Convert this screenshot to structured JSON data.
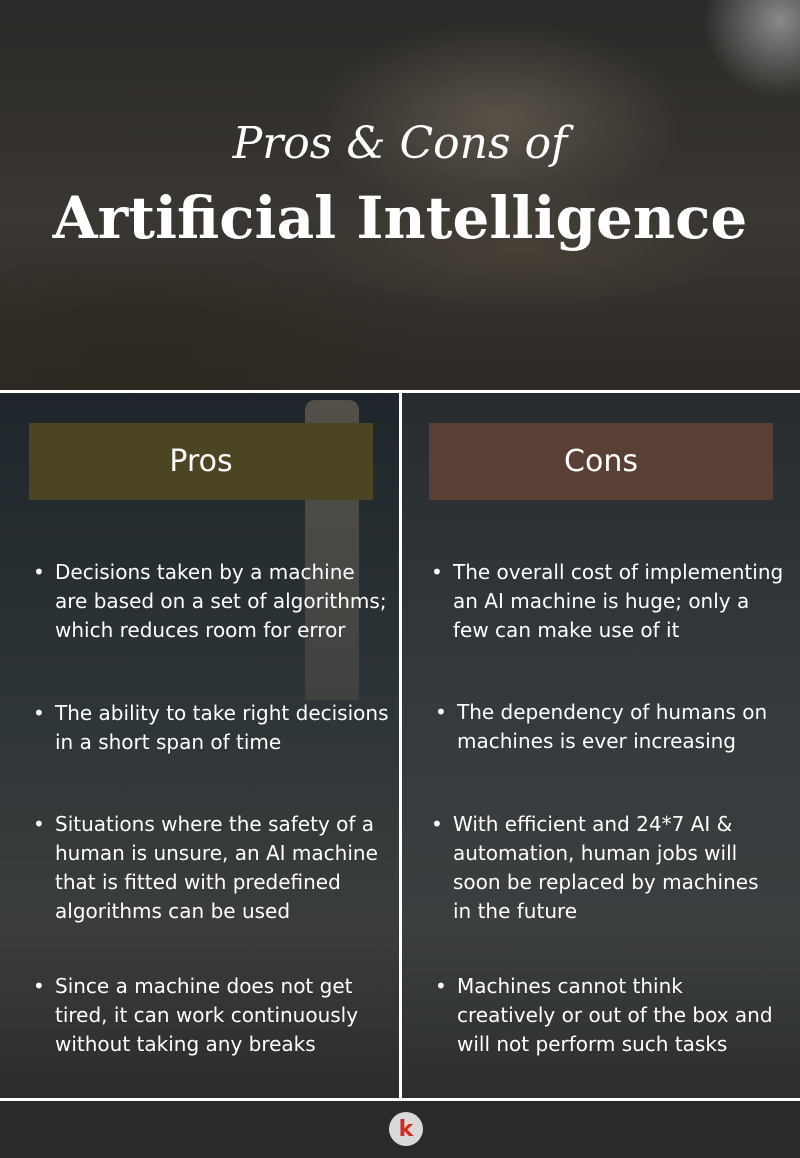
{
  "header": {
    "subtitle": "Pros & Cons of",
    "title": "Artificial Intelligence"
  },
  "pros": {
    "heading": "Pros",
    "items": [
      "Decisions taken by a machine are based on a set of algorithms; which reduces room for error",
      "The ability to take right decisions in a short span of time",
      "Situations where the safety of a human is unsure, an AI machine that is fitted with predefined algorithms can be used",
      "Since a machine does not get tired, it can work continuously without taking any breaks"
    ]
  },
  "cons": {
    "heading": "Cons",
    "items": [
      "The overall cost of implementing an AI machine is huge; only a few can make use of it",
      "The dependency of humans on machines is ever increasing",
      "With efficient and 24*7 AI & automation, human jobs will soon be replaced by machines in the future",
      "Machines cannot think creatively or out of the box and will not perform such tasks"
    ]
  },
  "logo": {
    "letter": "k",
    "icon": "brand-logo-icon"
  },
  "colors": {
    "pros_header": "#4b4524",
    "cons_header": "#5a3f34",
    "logo_letter": "#d42a1f"
  }
}
